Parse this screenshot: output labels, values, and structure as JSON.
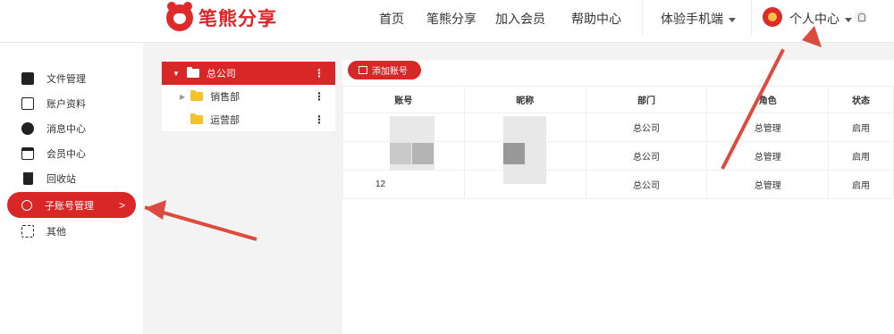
{
  "brand": {
    "name": "笔熊分享"
  },
  "nav": {
    "items": [
      {
        "label": "首页"
      },
      {
        "label": "笔熊分享"
      },
      {
        "label": "加入会员"
      },
      {
        "label": "帮助中心"
      }
    ],
    "mobile": "体验手机端",
    "profile": "个人中心"
  },
  "sidebar": {
    "items": [
      {
        "label": "文件管理",
        "icon": "folder-icon"
      },
      {
        "label": "账户资料",
        "icon": "id-card-icon"
      },
      {
        "label": "消息中心",
        "icon": "message-icon"
      },
      {
        "label": "会员中心",
        "icon": "card-icon"
      },
      {
        "label": "回收站",
        "icon": "trash-icon"
      },
      {
        "label": "子账号管理",
        "icon": "org-icon",
        "active": true
      },
      {
        "label": "其他",
        "icon": "grid-icon"
      }
    ],
    "active_chevron": ">"
  },
  "tree": {
    "root": "总公司",
    "children": [
      "销售部",
      "运营部"
    ],
    "menu": "⋮"
  },
  "toolbar": {
    "add_label": "添加账号"
  },
  "table": {
    "headers": [
      "账号",
      "昵称",
      "部门",
      "角色",
      "状态"
    ],
    "rows": [
      [
        "",
        "",
        "总公司",
        "总管理",
        "启用"
      ],
      [
        "",
        "",
        "总公司",
        "总管理",
        "启用"
      ],
      [
        "12",
        "",
        "总公司",
        "总管理",
        "启用"
      ]
    ]
  },
  "colors": {
    "accent": "#d92626",
    "arrow": "#dc4b3e"
  }
}
